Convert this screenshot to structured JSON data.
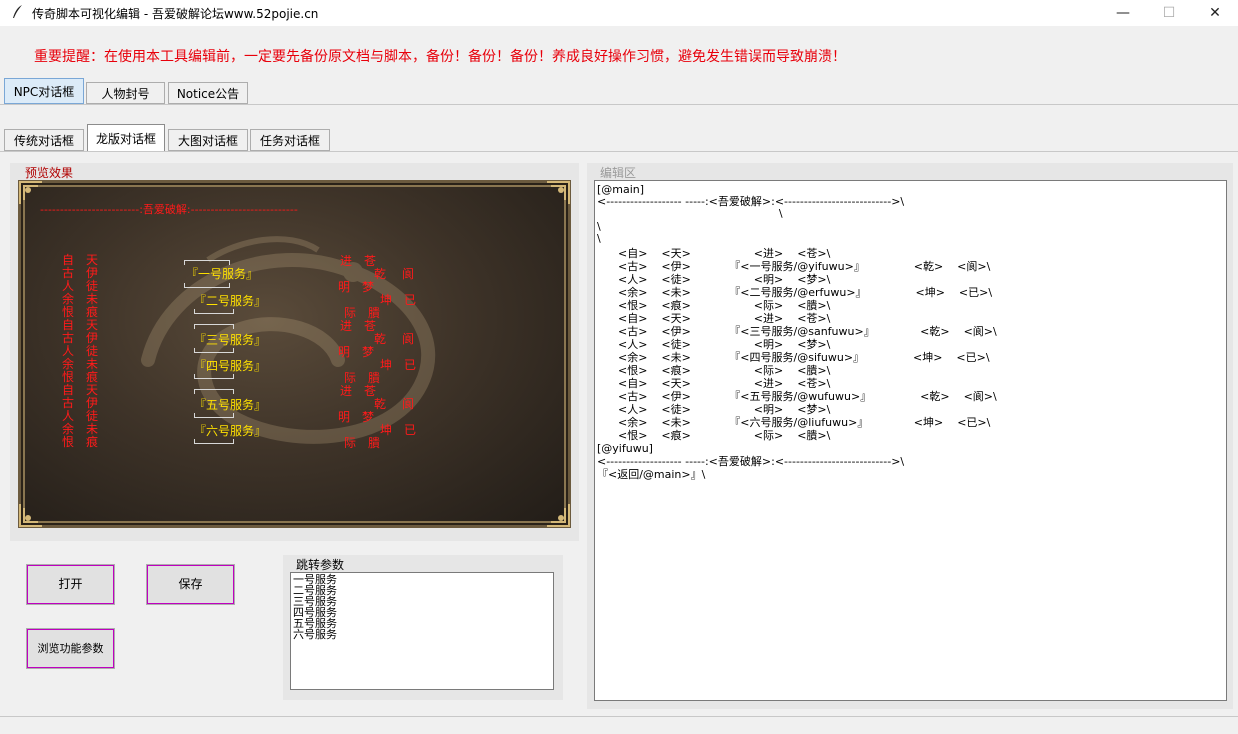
{
  "window": {
    "title": "传奇脚本可视化编辑 - 吾爱破解论坛www.52pojie.cn",
    "minimize_symbol": "—",
    "maximize_symbol": "☐",
    "close_symbol": "✕"
  },
  "warning": "重要提醒：在使用本工具编辑前，一定要先备份原文档与脚本，备份！备份！备份！养成良好操作习惯，避免发生错误而导致崩溃！",
  "top_tabs": [
    "NPC对话框",
    "人物封号",
    "Notice公告"
  ],
  "sub_tabs": [
    "传统对话框",
    "龙版对话框",
    "大图对话框",
    "任务对话框"
  ],
  "preview": {
    "label": "预览效果",
    "header": "-------------------------:吾爱破解:---------------------------",
    "left_col1": [
      "自",
      "古",
      "人",
      "余",
      "恨",
      "自",
      "古",
      "人",
      "余",
      "恨",
      "自",
      "古",
      "人",
      "余",
      "恨"
    ],
    "left_col2": [
      "天",
      "伊",
      "徒",
      "未",
      "痕",
      "天",
      "伊",
      "徒",
      "未",
      "痕",
      "天",
      "伊",
      "徒",
      "未",
      "痕"
    ],
    "services": [
      "『一号服务』",
      "『二号服务』",
      "『三号服务』",
      "『四号服务』",
      "『五号服务』",
      "『六号服务』"
    ],
    "right_words": [
      [
        "进",
        "苍"
      ],
      [
        "乾",
        "阆"
      ],
      [
        "明",
        "梦"
      ],
      [
        "坤",
        "已"
      ],
      [
        "际",
        "膭"
      ],
      [
        "进",
        "苍"
      ],
      [
        "乾",
        "阆"
      ],
      [
        "明",
        "梦"
      ],
      [
        "坤",
        "已"
      ],
      [
        "际",
        "膭"
      ],
      [
        "进",
        "苍"
      ],
      [
        "乾",
        "阆"
      ],
      [
        "明",
        "梦"
      ],
      [
        "坤",
        "已"
      ],
      [
        "际",
        "膭"
      ]
    ]
  },
  "buttons": {
    "open": "打开",
    "save": "保存",
    "browse": "浏览功能参数"
  },
  "jump": {
    "label": "跳转参数",
    "items": [
      "一号服务",
      "二号服务",
      "三号服务",
      "四号服务",
      "五号服务",
      "六号服务"
    ]
  },
  "editor": {
    "label": "编辑区",
    "lines": [
      "[@main]",
      "<------------------- -----:<吾爱破解>:<--------------------------->\\",
      "                                                    \\",
      "\\",
      "\\",
      "      <自>    <天>                  <进>    <苍>\\",
      "      <古>    <伊>           『<一号服务/@yifuwu>』              <乾>    <阆>\\",
      "      <人>    <徒>                  <明>    <梦>\\",
      "      <余>    <未>           『<二号服务/@erfuwu>』              <坤>    <已>\\",
      "      <恨>    <痕>                  <际>    <膭>\\",
      "      <自>    <天>                  <进>    <苍>\\",
      "      <古>    <伊>           『<三号服务/@sanfuwu>』             <乾>    <阆>\\",
      "      <人>    <徒>                  <明>    <梦>\\",
      "      <余>    <未>           『<四号服务/@sifuwu>』              <坤>    <已>\\",
      "      <恨>    <痕>                  <际>    <膭>\\",
      "      <自>    <天>                  <进>    <苍>\\",
      "      <古>    <伊>           『<五号服务/@wufuwu>』              <乾>    <阆>\\",
      "      <人>    <徒>                  <明>    <梦>\\",
      "      <余>    <未>           『<六号服务/@liufuwu>』             <坤>    <已>\\",
      "      <恨>    <痕>                  <际>    <膭>\\",
      "[@yifuwu]",
      "<------------------- -----:<吾爱破解>:<--------------------------->\\",
      "『<返回/@main>』\\"
    ]
  }
}
